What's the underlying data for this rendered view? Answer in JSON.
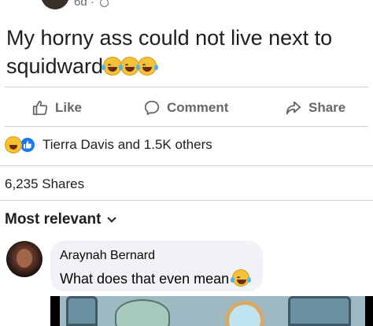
{
  "post": {
    "time": "6d",
    "text": "My horny ass could not live next to squidward"
  },
  "actions": {
    "like": "Like",
    "comment": "Comment",
    "share": "Share"
  },
  "reactions": {
    "names": "Tierra Davis and 1.5K others"
  },
  "shares": "6,235 Shares",
  "sort": {
    "label": "Most relevant"
  },
  "comment": {
    "author": "Araynah Bernard",
    "text": "What does that even mean"
  },
  "colors": {
    "accent": "#1877f2",
    "muted": "#65676b",
    "bubble": "#f0f2f5",
    "divider": "#ced0d4"
  },
  "icons": [
    "globe-icon",
    "laughing-crying-emoji",
    "like-icon",
    "comment-icon",
    "share-icon",
    "haha-reaction-icon",
    "like-reaction-icon",
    "chevron-down-icon"
  ]
}
